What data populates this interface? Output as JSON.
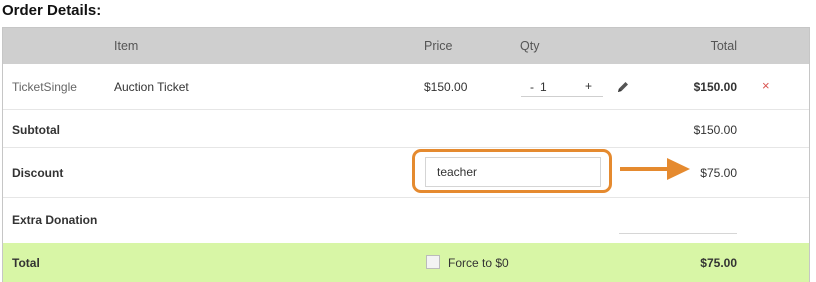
{
  "heading": "Order Details:",
  "columns": {
    "item": "Item",
    "price": "Price",
    "qty": "Qty",
    "total": "Total"
  },
  "line_item": {
    "type": "TicketSingle",
    "name": "Auction Ticket",
    "price": "$150.00",
    "qty_minus": "-",
    "qty_value": "1",
    "qty_plus": "+",
    "total": "$150.00",
    "remove": "×"
  },
  "subtotal": {
    "label": "Subtotal",
    "value": "$150.00"
  },
  "discount": {
    "label": "Discount",
    "code": "teacher",
    "value": "$75.00"
  },
  "extra_donation": {
    "label": "Extra Donation"
  },
  "total": {
    "label": "Total",
    "force_label": "Force to $0",
    "value": "$75.00"
  },
  "colors": {
    "header_bg": "#cfcfcf",
    "total_bg": "#d8f6a6",
    "highlight": "#e58a2f",
    "remove": "#d9534f"
  }
}
